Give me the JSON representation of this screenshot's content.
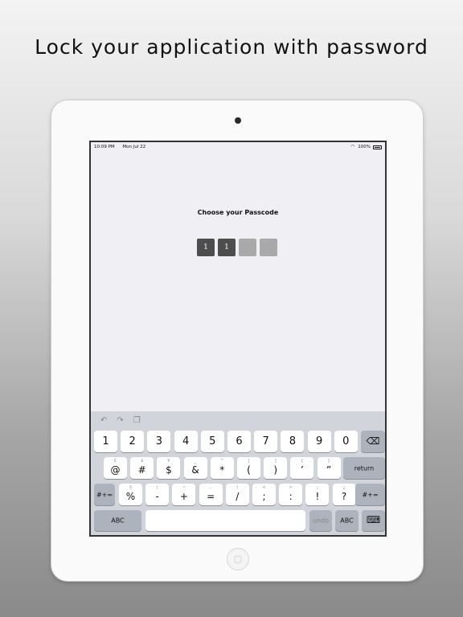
{
  "headline": "Lock your application with password",
  "status": {
    "time": "10:09 PM",
    "date": "Mon Jul 22",
    "battery": "100%"
  },
  "passcode": {
    "title": "Choose your Passcode",
    "digits": [
      "1",
      "1",
      "",
      ""
    ]
  },
  "keyboard": {
    "row1": [
      "1",
      "2",
      "3",
      "4",
      "5",
      "6",
      "7",
      "8",
      "9",
      "0"
    ],
    "row2": [
      {
        "main": "@",
        "sub": "€"
      },
      {
        "main": "#",
        "sub": "£"
      },
      {
        "main": "$",
        "sub": "¥"
      },
      {
        "main": "&",
        "sub": "_"
      },
      {
        "main": "*",
        "sub": "^"
      },
      {
        "main": "(",
        "sub": "["
      },
      {
        "main": ")",
        "sub": "]"
      },
      {
        "main": "’",
        "sub": "{"
      },
      {
        "main": "”",
        "sub": "}"
      }
    ],
    "row3": [
      {
        "main": "%",
        "sub": "§"
      },
      {
        "main": "-",
        "sub": "|"
      },
      {
        "main": "+",
        "sub": "~"
      },
      {
        "main": "=",
        "sub": "…"
      },
      {
        "main": "/",
        "sub": "\\"
      },
      {
        "main": ";",
        "sub": "<"
      },
      {
        "main": ":",
        "sub": ">"
      },
      {
        "main": "!",
        "sub": "¡"
      },
      {
        "main": "?",
        "sub": "¿"
      }
    ],
    "return_label": "return",
    "shift_label": "#+=",
    "abc_label": "ABC",
    "undo_label": "undo"
  }
}
